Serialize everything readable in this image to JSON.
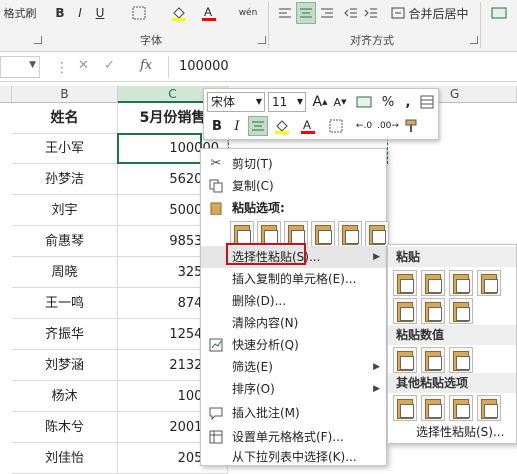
{
  "ribbon": {
    "format_painter": "格式刷",
    "font_group": "字体",
    "align_group": "对齐方式",
    "bold": "B",
    "italic": "I",
    "underline": "U",
    "merge_center": "合并后居中"
  },
  "formula_bar": {
    "cancel": "✕",
    "confirm": "✓",
    "fx": "fx",
    "value": "100000"
  },
  "columns": [
    "B",
    "C",
    "G"
  ],
  "table": {
    "header": [
      "姓名",
      "5月份销售"
    ],
    "rows": [
      {
        "name": "王小军",
        "value": "100000"
      },
      {
        "name": "孙梦洁",
        "value": "562010"
      },
      {
        "name": "刘宇",
        "value": "500000"
      },
      {
        "name": "俞惠琴",
        "value": "985314"
      },
      {
        "name": "周晓",
        "value": "32540"
      },
      {
        "name": "王一鸣",
        "value": "87456"
      },
      {
        "name": "齐振华",
        "value": "125478"
      },
      {
        "name": "刘梦涵",
        "value": "213258"
      },
      {
        "name": "杨沐",
        "value": "10000"
      },
      {
        "name": "陈木兮",
        "value": "200144"
      },
      {
        "name": "刘佳怡",
        "value": "20541"
      }
    ]
  },
  "mini_toolbar": {
    "font": "宋体",
    "size": "11",
    "grow": "A",
    "shrink": "A",
    "percent": "%",
    "comma": ",",
    "bold": "B",
    "italic": "I"
  },
  "context_menu": {
    "items": [
      {
        "label": "剪切(T)",
        "icon": "cut-icon"
      },
      {
        "label": "复制(C)",
        "icon": "copy-icon"
      },
      {
        "label": "粘贴选项:",
        "icon": "paste-icon"
      },
      {
        "label": "选择性粘贴(S)...",
        "icon": ""
      },
      {
        "label": "插入复制的单元格(E)...",
        "icon": ""
      },
      {
        "label": "删除(D)...",
        "icon": ""
      },
      {
        "label": "清除内容(N)",
        "icon": ""
      },
      {
        "label": "快速分析(Q)",
        "icon": "quick-analysis-icon"
      },
      {
        "label": "筛选(E)",
        "icon": ""
      },
      {
        "label": "排序(O)",
        "icon": ""
      },
      {
        "label": "插入批注(M)",
        "icon": "comment-icon"
      },
      {
        "label": "设置单元格格式(F)...",
        "icon": "format-cells-icon"
      },
      {
        "label": "从下拉列表中选择(K)...",
        "icon": ""
      }
    ]
  },
  "submenu": {
    "paste_header": "粘贴",
    "paste_values_header": "粘贴数值",
    "other_header": "其他粘贴选项",
    "paste_special": "选择性粘贴(S)..."
  },
  "colors": {
    "highlight": "#c0151c",
    "green_accent": "#217346",
    "font_color": "#ff0000",
    "fill_color": "#ffff00"
  }
}
